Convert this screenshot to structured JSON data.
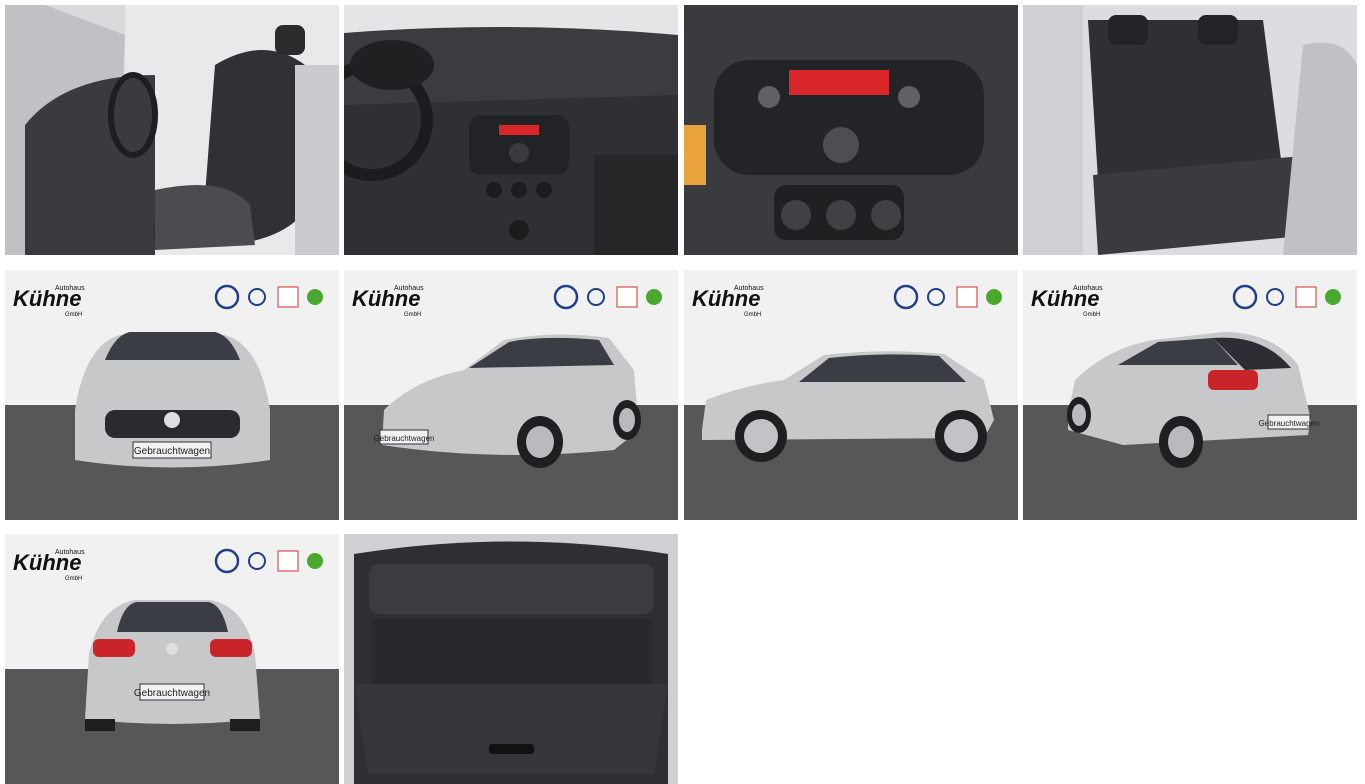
{
  "gallery": {
    "dealer": {
      "name_small": "Autohaus",
      "name_big": "Kühne",
      "suffix": "GmbH",
      "brand_marks": [
        "VW",
        "VW Nutzfahrzeuge",
        "Audi",
        "Škoda"
      ]
    },
    "plate_text": "Gebrauchtwagen",
    "colors": {
      "car_silver": "#c7c8ca",
      "floor": "#555759",
      "backdrop": "#f1f1f1",
      "interior_dark": "#2b2c2e",
      "display_red": "#d8262b"
    },
    "photos": [
      {
        "view": "interior-driver-side",
        "icon": "photo-interior-seat"
      },
      {
        "view": "dashboard",
        "icon": "photo-dashboard"
      },
      {
        "view": "center-console",
        "icon": "photo-console"
      },
      {
        "view": "rear-seats",
        "icon": "photo-rear-seats"
      },
      {
        "view": "front",
        "icon": "photo-car-front"
      },
      {
        "view": "front-three-quarter",
        "icon": "photo-car-front-angle"
      },
      {
        "view": "side",
        "icon": "photo-car-side"
      },
      {
        "view": "rear-three-quarter",
        "icon": "photo-car-rear-angle"
      },
      {
        "view": "rear",
        "icon": "photo-car-rear"
      },
      {
        "view": "trunk",
        "icon": "photo-trunk"
      }
    ]
  }
}
